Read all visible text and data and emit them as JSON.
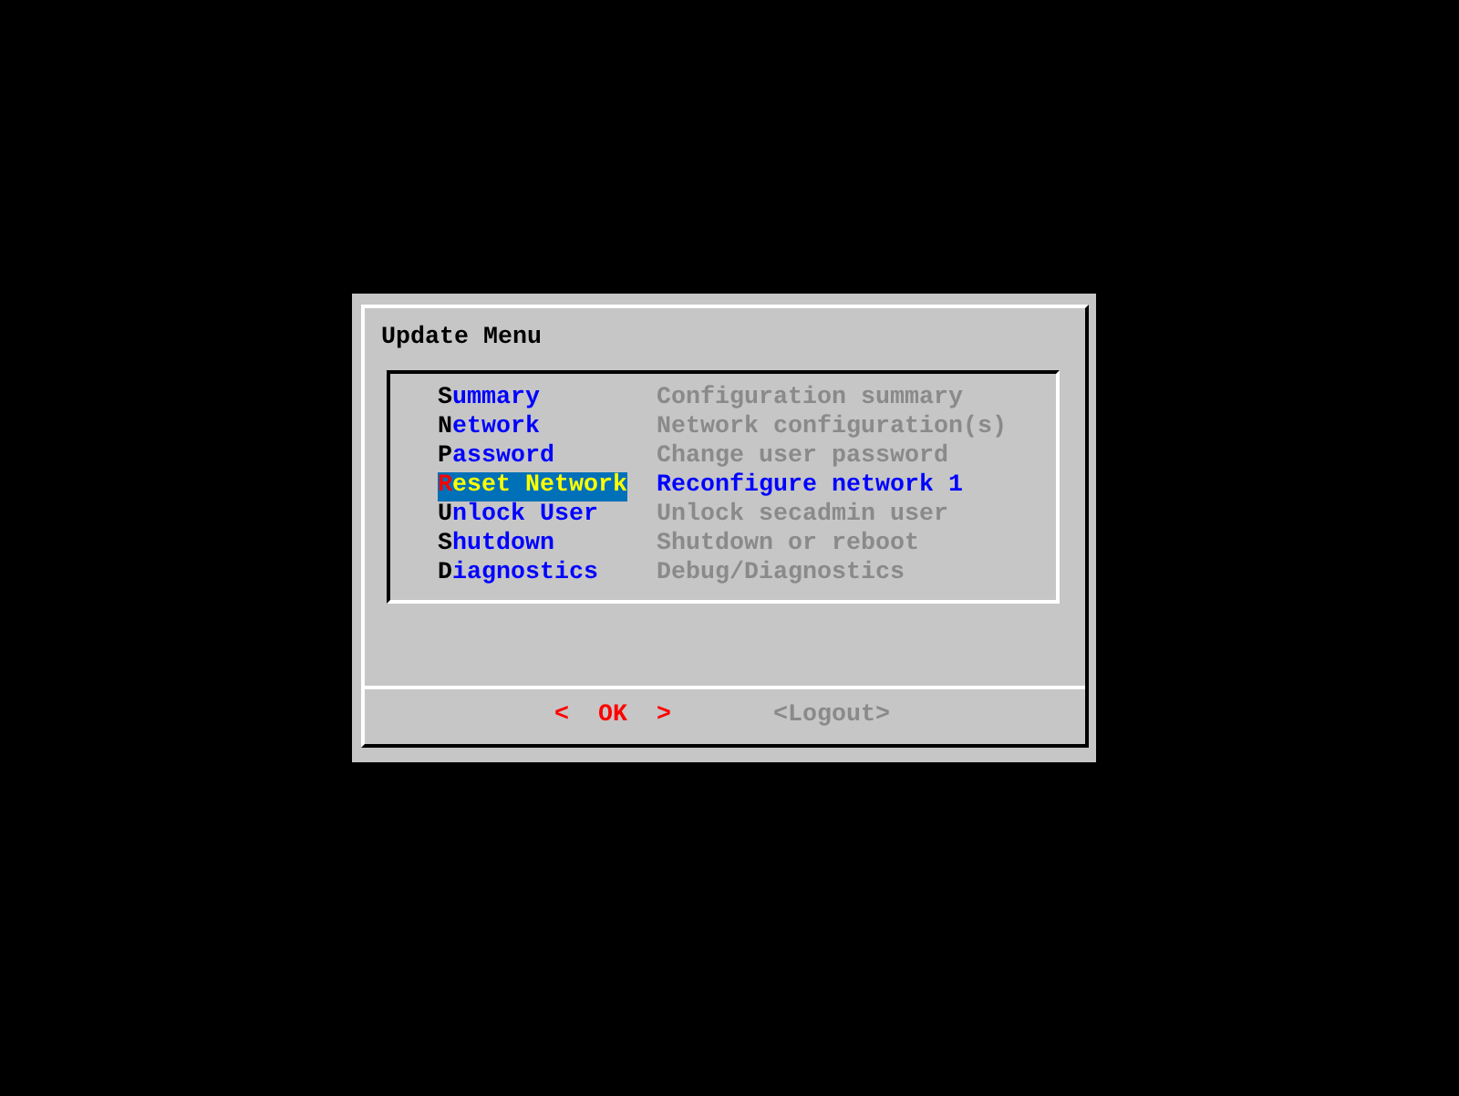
{
  "dialog": {
    "title": "Update Menu",
    "menu_items": [
      {
        "label": "Summary",
        "description": "Configuration summary",
        "selected": false
      },
      {
        "label": "Network",
        "description": "Network configuration(s)",
        "selected": false
      },
      {
        "label": "Password",
        "description": "Change user password",
        "selected": false
      },
      {
        "label": "Reset Network",
        "description": "Reconfigure network 1",
        "selected": true
      },
      {
        "label": "Unlock User",
        "description": "Unlock secadmin user",
        "selected": false
      },
      {
        "label": "Shutdown",
        "description": "Shutdown or reboot",
        "selected": false
      },
      {
        "label": "Diagnostics",
        "description": "Debug/Diagnostics",
        "selected": false
      }
    ],
    "buttons": [
      {
        "label": "<  OK  >",
        "selected": true
      },
      {
        "label": "<Logout>",
        "selected": false
      }
    ]
  }
}
